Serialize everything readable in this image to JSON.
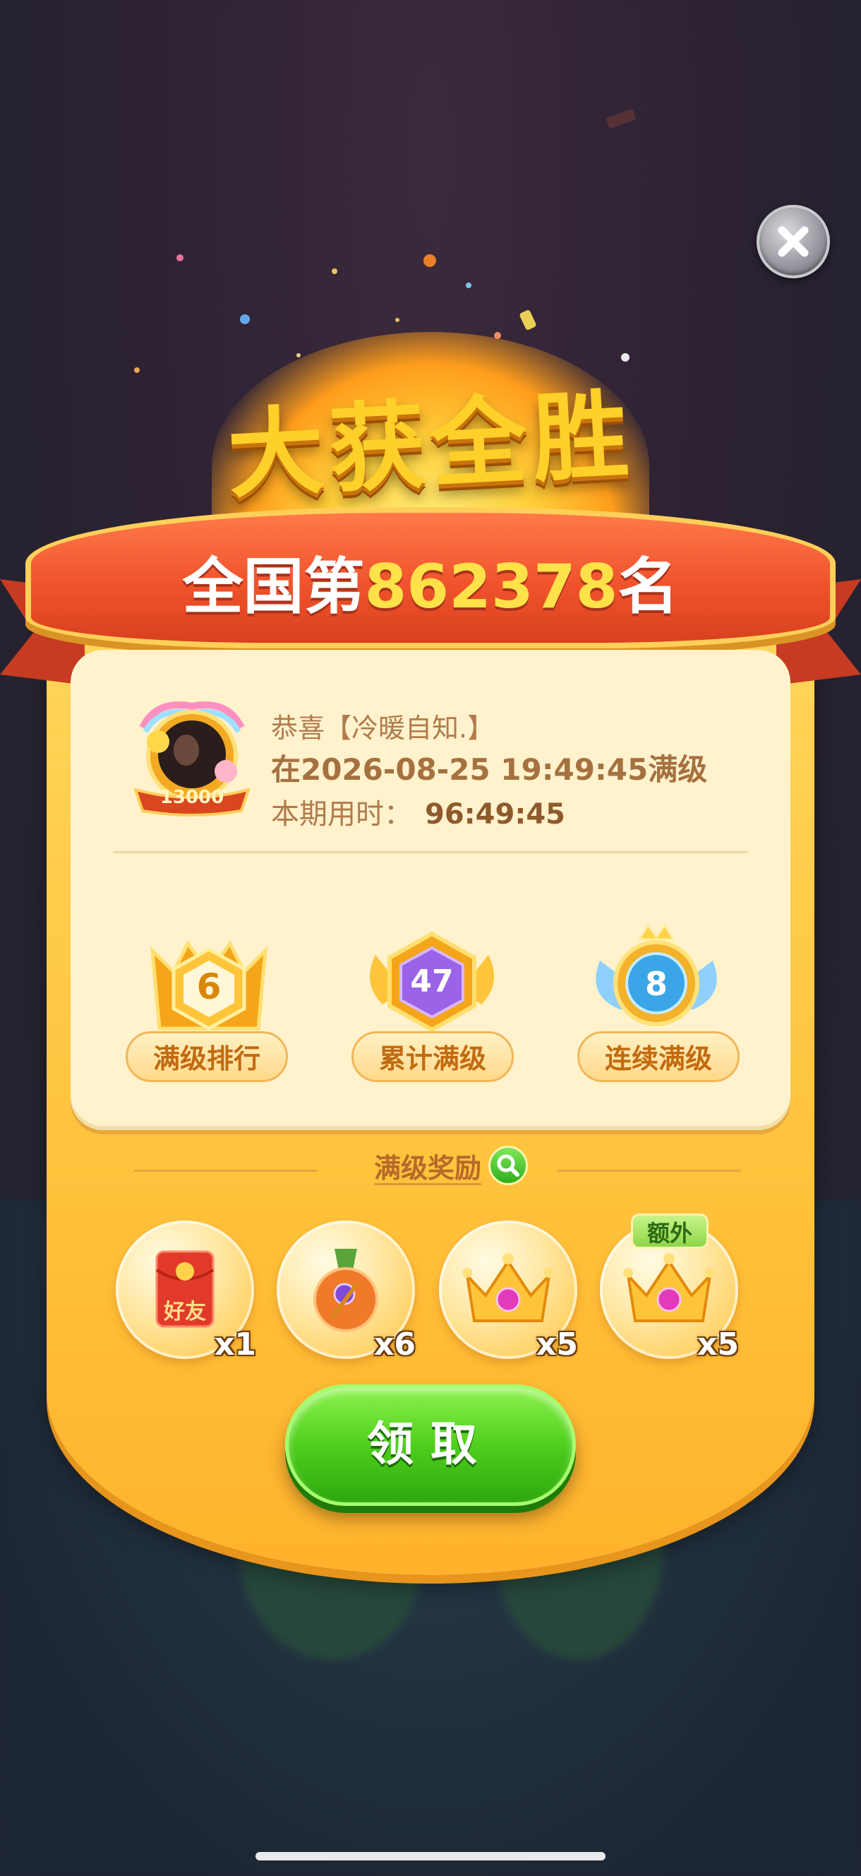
{
  "title": "大获全胜",
  "rank": {
    "prefix": "全国第",
    "number": "862378",
    "suffix": "名"
  },
  "profile": {
    "avatar_badge": "13000",
    "congrats": "恭喜【冷暖自知.】",
    "level_line": "在2026-08-25 19:49:45满级",
    "time_label": "本期用时：",
    "time_value": "96:49:45"
  },
  "stats": [
    {
      "value": "6",
      "label": "满级排行",
      "color": "#f6a516"
    },
    {
      "value": "47",
      "label": "累计满级",
      "color": "#9b63e8"
    },
    {
      "value": "8",
      "label": "连续满级",
      "color": "#3aa6e8"
    }
  ],
  "rewards": {
    "title": "满级奖励",
    "items": [
      {
        "icon": "red-envelope-icon",
        "icon_text": "好友",
        "qty": "x1"
      },
      {
        "icon": "magic-potion-icon",
        "qty": "x6"
      },
      {
        "icon": "crown-icon",
        "qty": "x5"
      },
      {
        "icon": "crown-icon",
        "qty": "x5",
        "tag": "额外"
      }
    ]
  },
  "claim_button": "领取",
  "colors": {
    "accent": "#ffc23b",
    "ribbon": "#f0532c",
    "button": "#4fcf1d"
  }
}
